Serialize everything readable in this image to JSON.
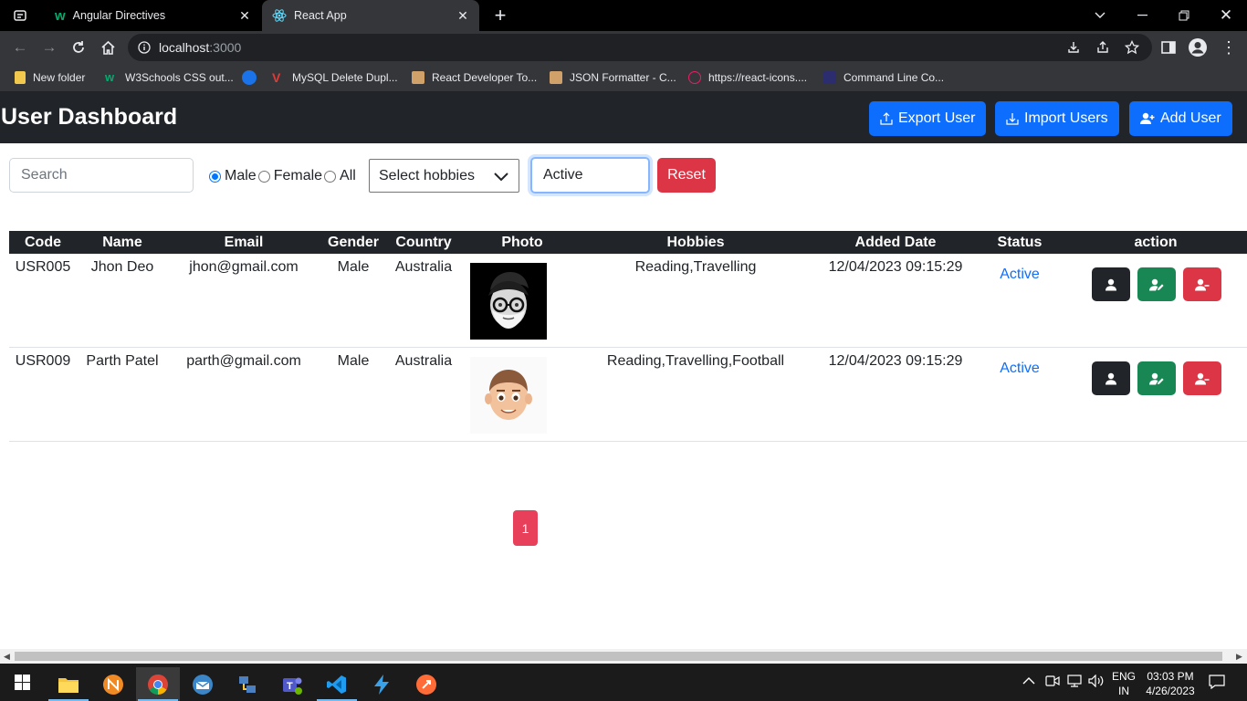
{
  "browser": {
    "tabs": [
      {
        "title": "Angular Directives",
        "icon": "w3schools-icon"
      },
      {
        "title": "React App",
        "icon": "react-icon",
        "active": true
      }
    ],
    "url_host": "localhost",
    "url_port": ":3000",
    "bookmarks": [
      {
        "label": "New folder",
        "color": "#f2c94c"
      },
      {
        "label": "W3Schools CSS out...",
        "color": "#04aa6d"
      },
      {
        "label": "",
        "color": "#1a73e8"
      },
      {
        "label": "MySQL Delete Dupl...",
        "color": "#e53935"
      },
      {
        "label": "React Developer To...",
        "color": "#d0a26a"
      },
      {
        "label": "JSON Formatter - C...",
        "color": "#d0a26a"
      },
      {
        "label": "https://react-icons....",
        "color": "#e91e63"
      },
      {
        "label": "Command Line Co...",
        "color": "#2b2d6e"
      }
    ]
  },
  "app": {
    "title": "User Dashboard",
    "buttons": {
      "export": "Export User",
      "import": "Import Users",
      "add": "Add User"
    },
    "filters": {
      "search_placeholder": "Search",
      "gender_options": [
        "Male",
        "Female",
        "All"
      ],
      "gender_selected": "Male",
      "hobbies_placeholder": "Select hobbies",
      "status_value": "Active",
      "reset_label": "Reset"
    },
    "table": {
      "headers": [
        "Code",
        "Name",
        "Email",
        "Gender",
        "Country",
        "Photo",
        "Hobbies",
        "Added Date",
        "Status",
        "action"
      ],
      "rows": [
        {
          "code": "USR005",
          "name": "Jhon Deo",
          "email": "jhon@gmail.com",
          "gender": "Male",
          "country": "Australia",
          "photo": "avatar-dark-bg",
          "hobbies": "Reading,Travelling",
          "added": "12/04/2023 09:15:29",
          "status": "Active"
        },
        {
          "code": "USR009",
          "name": "Parth Patel",
          "email": "parth@gmail.com",
          "gender": "Male",
          "country": "Australia",
          "photo": "avatar-light-bg",
          "hobbies": "Reading,Travelling,Football",
          "added": "12/04/2023 09:15:29",
          "status": "Active"
        }
      ]
    },
    "pagination": {
      "current": "1"
    }
  },
  "taskbar": {
    "lang": "ENG",
    "region": "IN",
    "time": "03:03 PM",
    "date": "4/26/2023"
  }
}
